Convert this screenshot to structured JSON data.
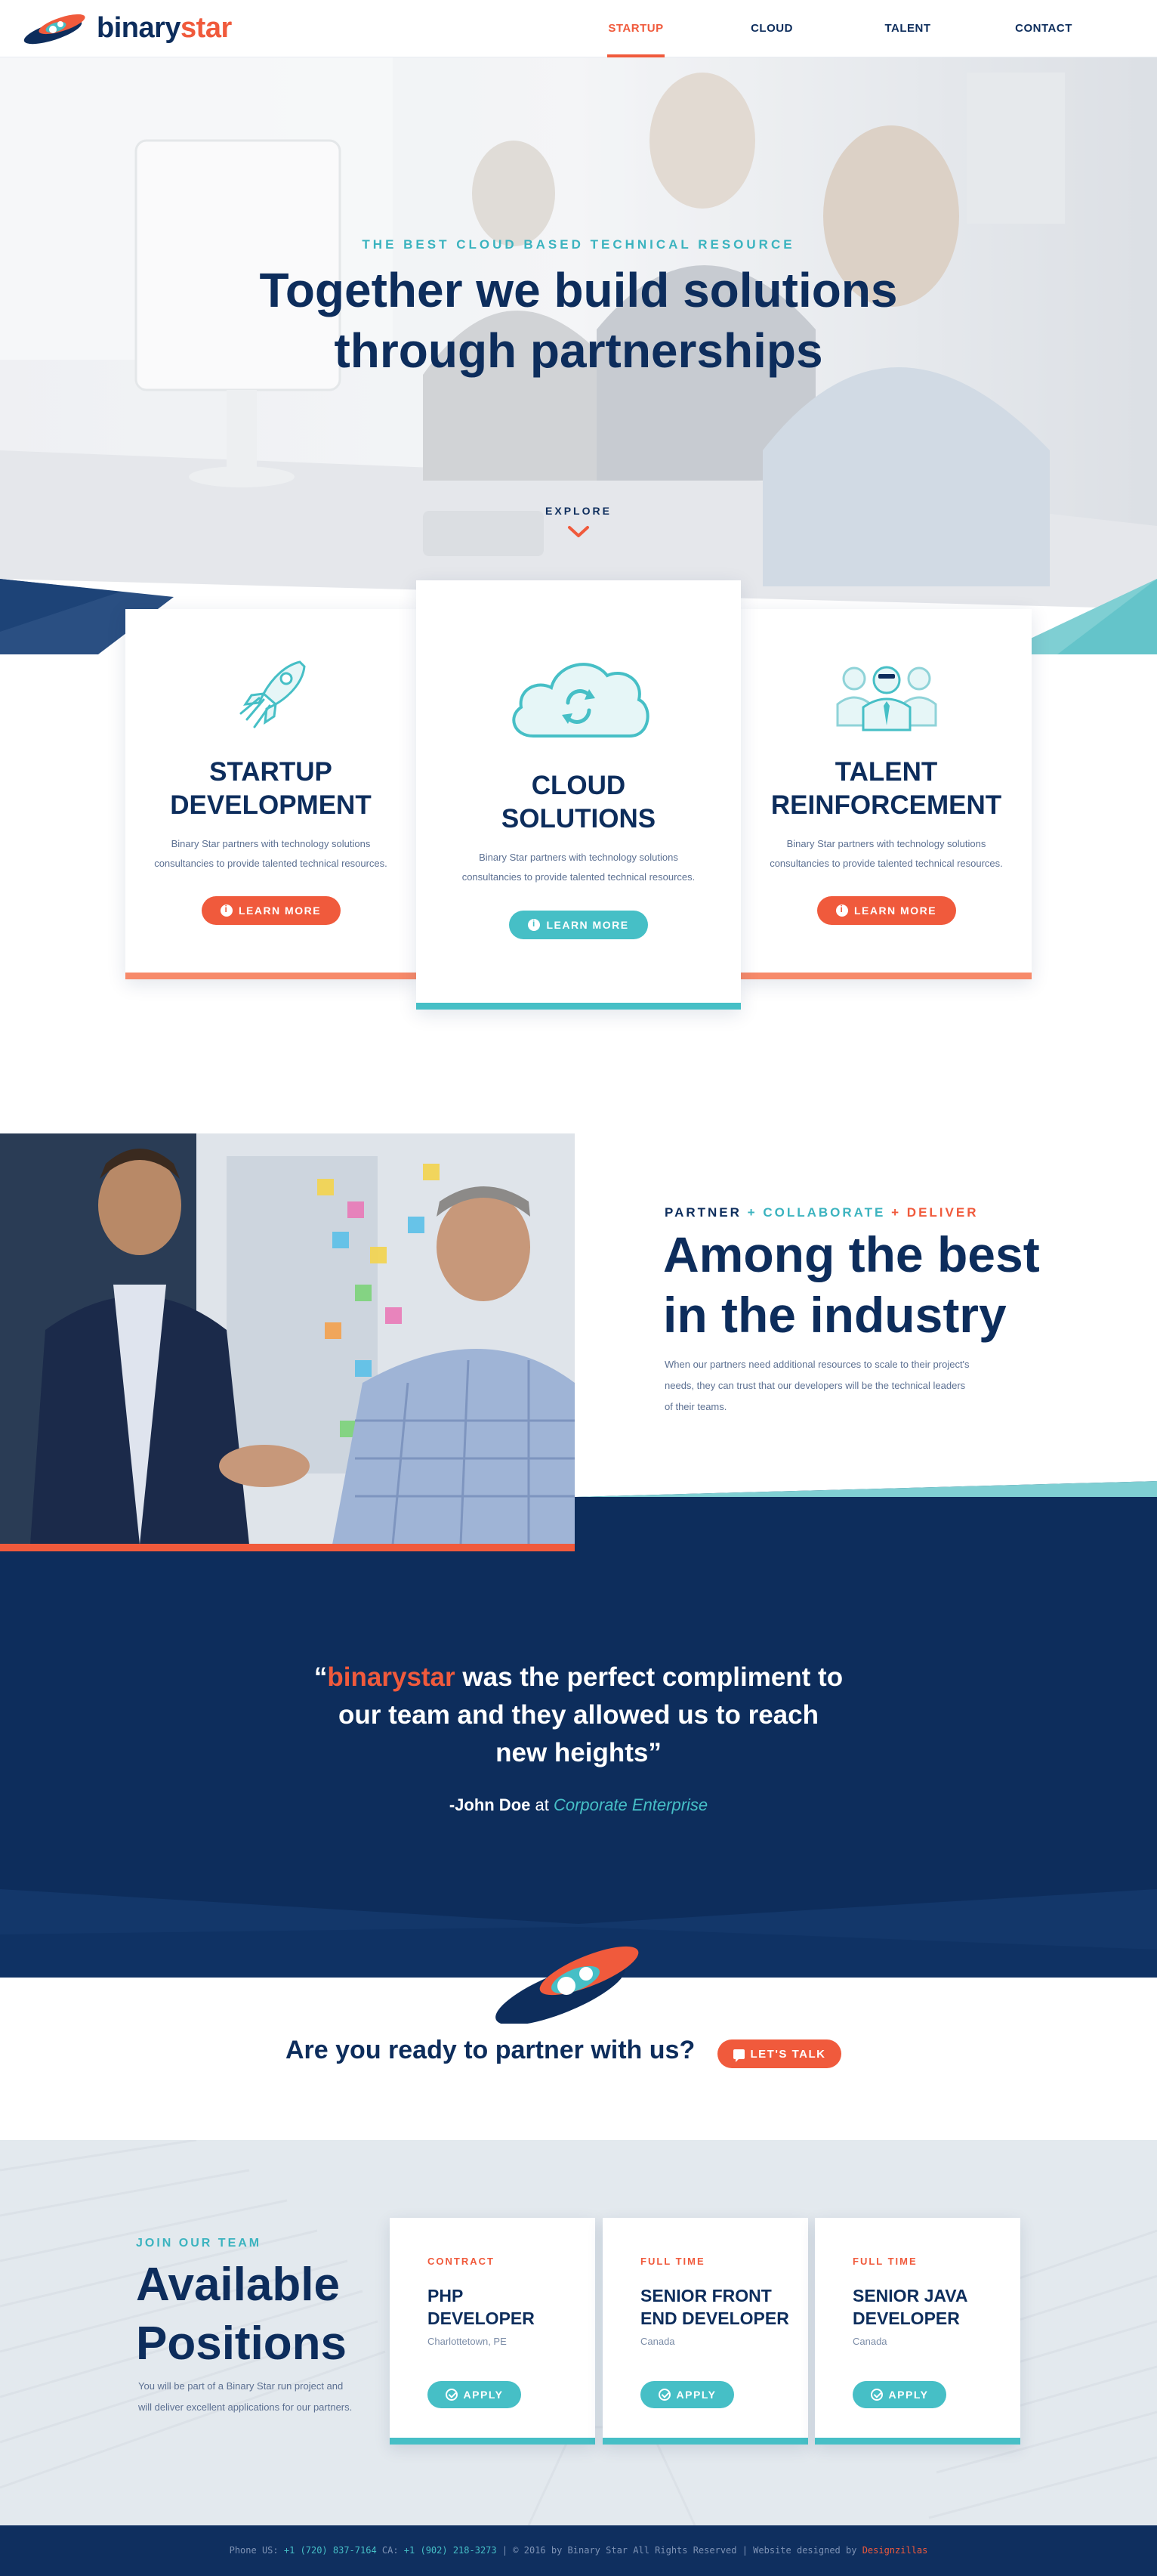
{
  "brand": {
    "name_part1": "binary",
    "name_part2": "star"
  },
  "nav": {
    "items": [
      {
        "label": "STARTUP"
      },
      {
        "label": "CLOUD"
      },
      {
        "label": "TALENT"
      },
      {
        "label": "CONTACT"
      }
    ]
  },
  "hero": {
    "eyebrow": "THE BEST CLOUD BASED TECHNICAL RESOURCE",
    "title_line1": "Together we build solutions",
    "title_line2": "through partnerships",
    "explore": "EXPLORE"
  },
  "services": [
    {
      "title_line1": "STARTUP",
      "title_line2": "DEVELOPMENT",
      "text_line1": "Binary Star partners with technology solutions",
      "text_line2": "consultancies to provide talented technical resources.",
      "button": "LEARN MORE",
      "icon": "rocket-icon"
    },
    {
      "title_line1": "CLOUD",
      "title_line2": "SOLUTIONS",
      "text_line1": "Binary Star partners with technology solutions",
      "text_line2": "consultancies to provide talented technical resources.",
      "button": "LEARN MORE",
      "icon": "cloud-sync-icon"
    },
    {
      "title_line1": "TALENT",
      "title_line2": "REINFORCEMENT",
      "text_line1": "Binary Star partners with technology solutions",
      "text_line2": "consultancies to provide talented technical resources.",
      "button": "LEARN MORE",
      "icon": "team-icon"
    }
  ],
  "industry": {
    "eyebrow_1": "PARTNER",
    "eyebrow_plus1": "+",
    "eyebrow_2": "COLLABORATE",
    "eyebrow_plus2": "+",
    "eyebrow_3": "DELIVER",
    "title_line1": "Among the best",
    "title_line2": "in the industry",
    "text_line1": "When our partners need additional resources to scale to their project's",
    "text_line2": "needs, they can trust that our developers will be the technical leaders",
    "text_line3": "of their teams."
  },
  "testimonial": {
    "open_quote": "“",
    "brand": "binarystar",
    "line1_rest": " was the perfect compliment to",
    "line2": "our team and they allowed us to reach",
    "line3": "new heights”",
    "author": "-John Doe",
    "at": " at ",
    "company": "Corporate Enterprise"
  },
  "cta": {
    "text": "Are you ready to partner with us?",
    "button": "LET'S TALK"
  },
  "positions": {
    "eyebrow": "JOIN OUR TEAM",
    "title_line1": "Available",
    "title_line2": "Positions",
    "text_line1": "You will be part of a Binary Star run project and",
    "text_line2": "will deliver excellent applications for our partners.",
    "jobs": [
      {
        "type": "CONTRACT",
        "title_line1": "PHP",
        "title_line2": "DEVELOPER",
        "location": "Charlottetown, PE",
        "button": "APPLY"
      },
      {
        "type": "FULL TIME",
        "title_line1": "SENIOR FRONT",
        "title_line2": "END DEVELOPER",
        "location": "Canada",
        "button": "APPLY"
      },
      {
        "type": "FULL TIME",
        "title_line1": "SENIOR JAVA",
        "title_line2": "DEVELOPER",
        "location": "Canada",
        "button": "APPLY"
      }
    ]
  },
  "footer": {
    "phone_us_label": "Phone US: ",
    "phone_us": "+1 (720) 837-7164",
    "phone_ca_label": " CA: ",
    "phone_ca": "+1 (902) 218-3273",
    "rights": " | © 2016 by Binary Star All Rights Reserved | Website designed by ",
    "designer": "Designzillas"
  },
  "colors": {
    "navy": "#0d2d5c",
    "orange": "#f05a3c",
    "teal": "#46bfc6",
    "light_orange": "#f78a6a"
  }
}
